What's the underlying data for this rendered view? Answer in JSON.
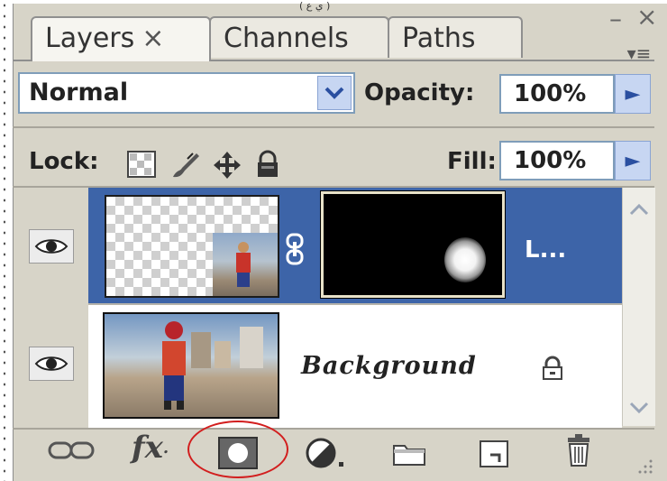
{
  "caption": "( ي ع )",
  "tabs": [
    {
      "label": "Layers",
      "active": true,
      "close": "×"
    },
    {
      "label": "Channels",
      "active": false
    },
    {
      "label": "Paths",
      "active": false
    }
  ],
  "window_controls": {
    "minimize": "–",
    "close": "×",
    "menu": "▾≡"
  },
  "blend": {
    "mode": "Normal",
    "opacity_label": "Opacity:",
    "opacity_value": "100%"
  },
  "lock": {
    "label": "Lock:",
    "fill_label": "Fill:",
    "fill_value": "100%"
  },
  "layers": [
    {
      "name": "L...",
      "visible": true,
      "selected": true,
      "has_mask": true
    },
    {
      "name": "Background",
      "visible": true,
      "selected": false,
      "locked": true
    }
  ],
  "toolbar_icons": [
    "link-layers-icon",
    "fx-icon",
    "add-mask-icon",
    "adjustment-layer-icon",
    "group-folder-icon",
    "new-layer-icon",
    "trash-icon"
  ],
  "toolbar": {
    "fx_label": "fx"
  },
  "colors": {
    "selected_row": "#3d64a8",
    "panel_bg": "#d7d4c8",
    "highlight_circle": "#d21e1e"
  }
}
